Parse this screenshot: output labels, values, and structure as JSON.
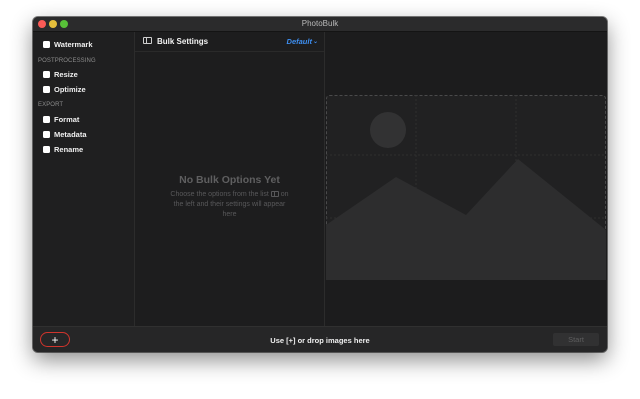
{
  "window": {
    "title": "PhotoBulk"
  },
  "sidebar": {
    "top_items": [
      {
        "label": "Watermark",
        "checked": false
      }
    ],
    "sections": [
      {
        "header": "POSTPROCESSING",
        "items": [
          {
            "label": "Resize",
            "checked": false
          },
          {
            "label": "Optimize",
            "checked": false
          }
        ]
      },
      {
        "header": "EXPORT",
        "items": [
          {
            "label": "Format",
            "checked": false
          },
          {
            "label": "Metadata",
            "checked": false
          },
          {
            "label": "Rename",
            "checked": false
          }
        ]
      }
    ]
  },
  "settings": {
    "title": "Bulk Settings",
    "preset": "Default",
    "empty_title": "No Bulk Options Yet",
    "empty_desc_1": "Choose the options from the list",
    "empty_desc_2": "on the left and their settings will appear here"
  },
  "bottom": {
    "add_label": "+",
    "drop_hint": "Use [+] or drop images here",
    "start_label": "Start"
  },
  "colors": {
    "accent": "#3d8ef0",
    "highlight": "#d0342c",
    "window_bg": "#1c1c1d"
  },
  "icons": [
    "sidebar-toggle-icon",
    "chevron-down-icon",
    "image-placeholder-icon"
  ]
}
